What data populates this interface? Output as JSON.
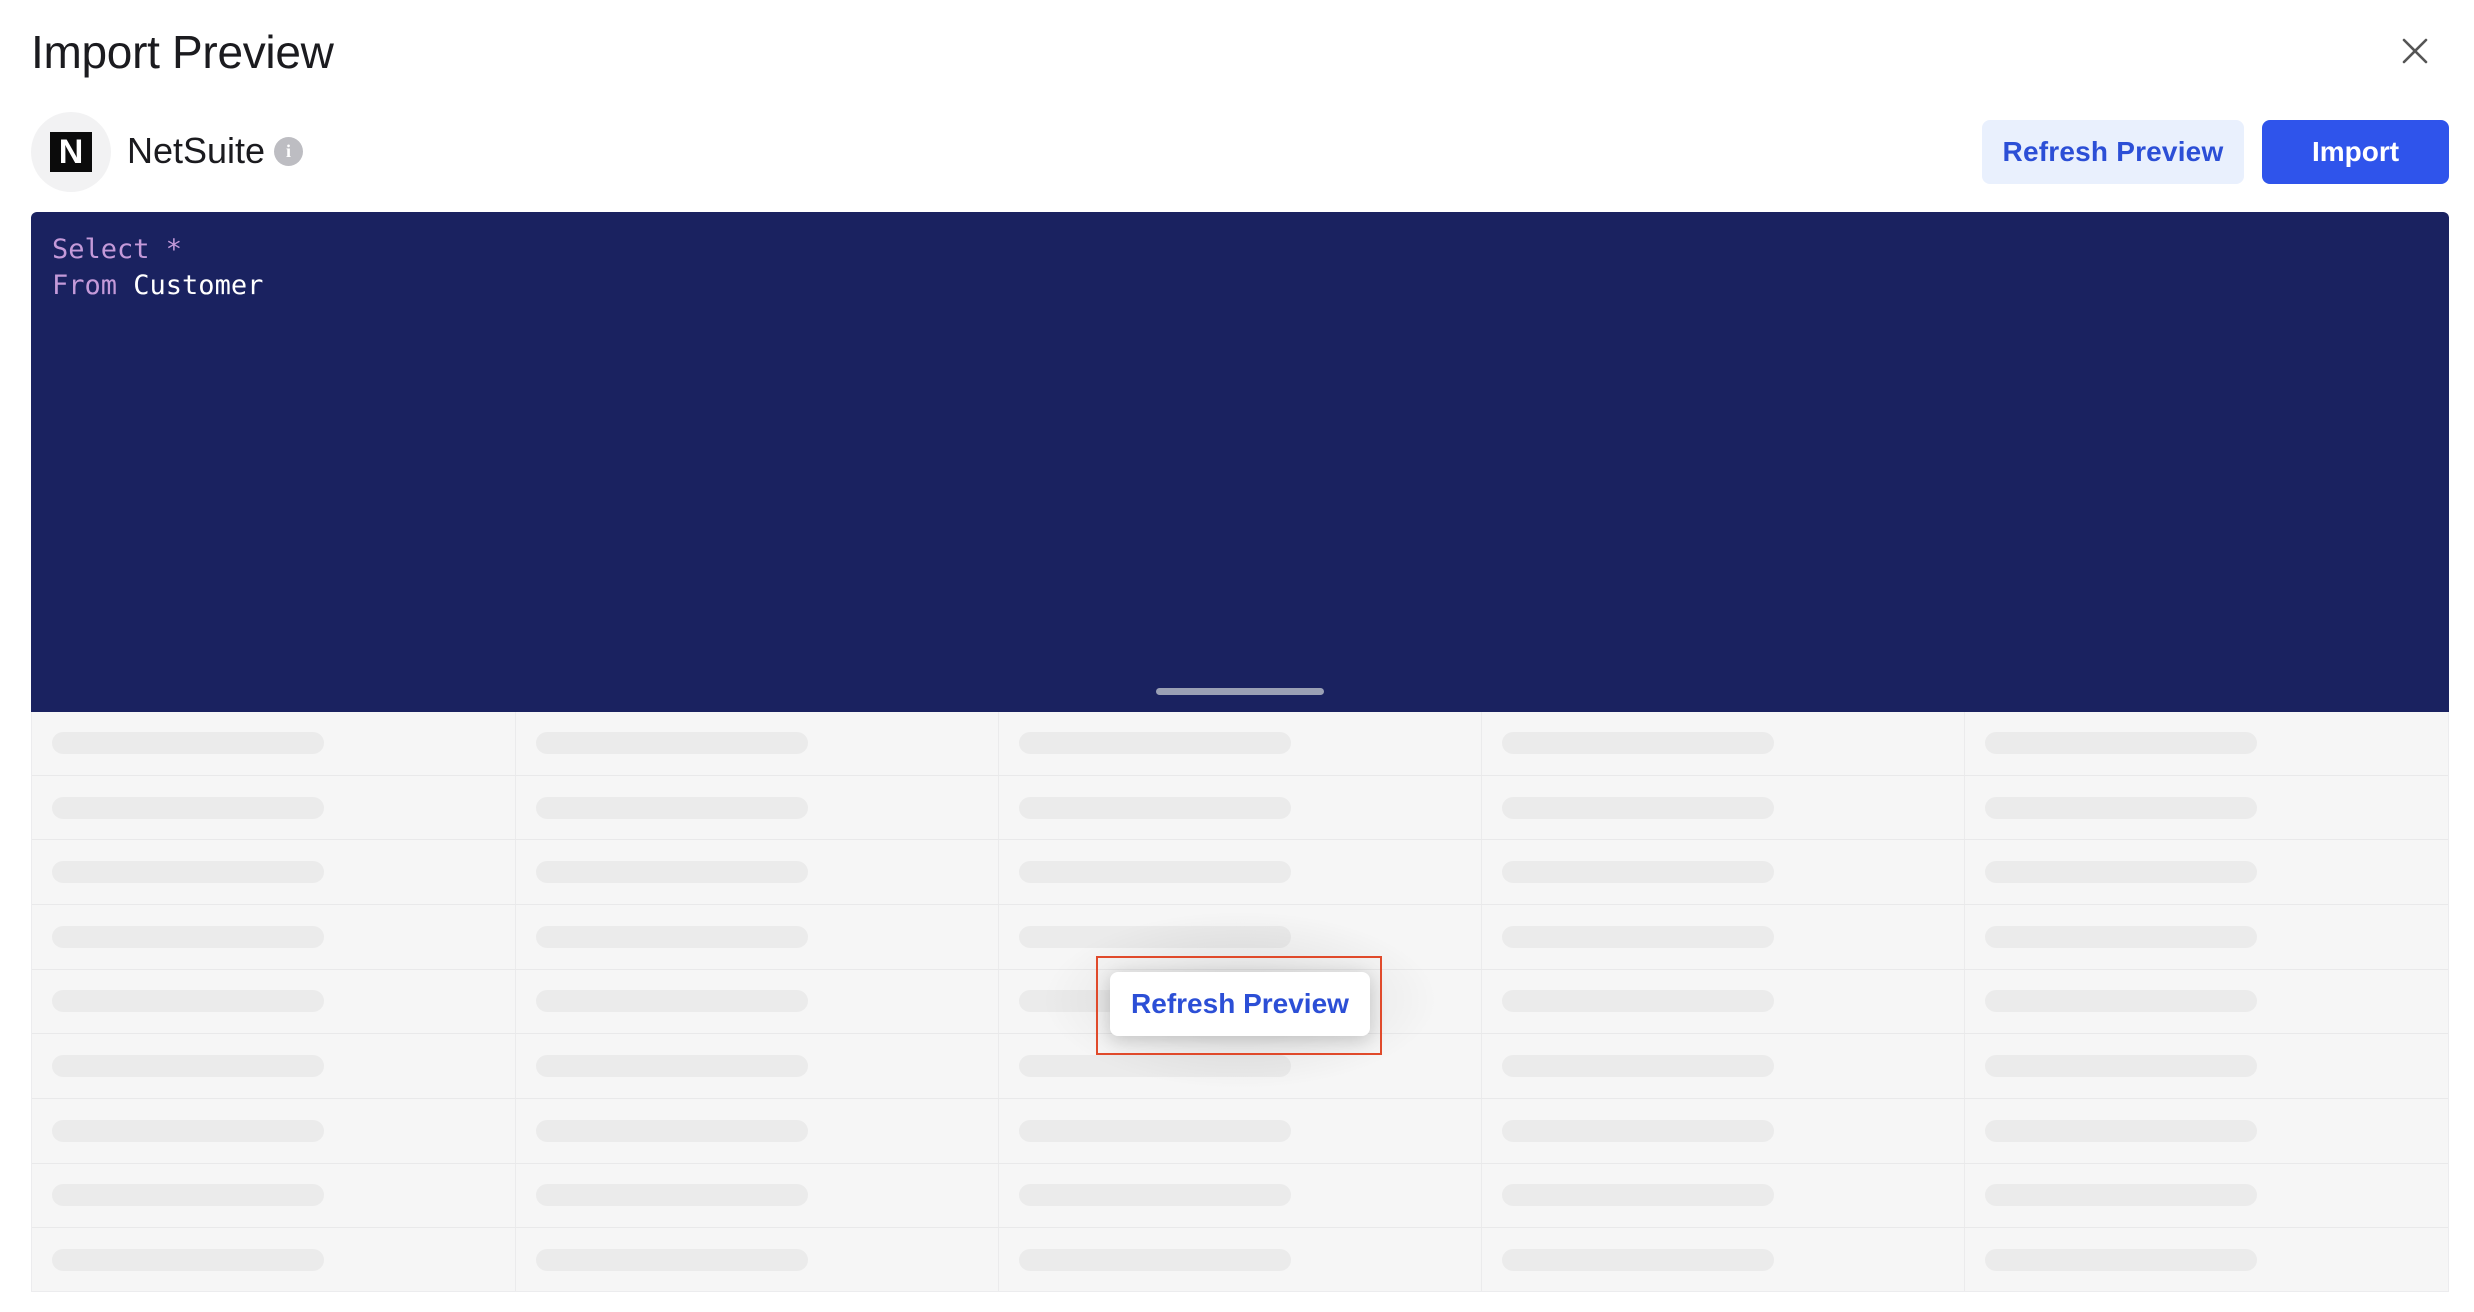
{
  "dialog": {
    "title": "Import Preview",
    "close_icon": "close-icon"
  },
  "source": {
    "logo_letter": "N",
    "name": "NetSuite",
    "info_icon": "info-icon"
  },
  "toolbar": {
    "refresh_label": "Refresh Preview",
    "import_label": "Import"
  },
  "editor": {
    "lines": [
      {
        "keyword": "Select",
        "rest": " *"
      },
      {
        "keyword": "From",
        "rest": " Customer"
      }
    ]
  },
  "preview": {
    "refresh_label": "Refresh Preview",
    "columns": 5,
    "rows": 9
  },
  "colors": {
    "editor_bg": "#1a2260",
    "primary": "#2f54eb",
    "secondary_bg": "#e9f0fd",
    "highlight": "#e04a2b"
  }
}
